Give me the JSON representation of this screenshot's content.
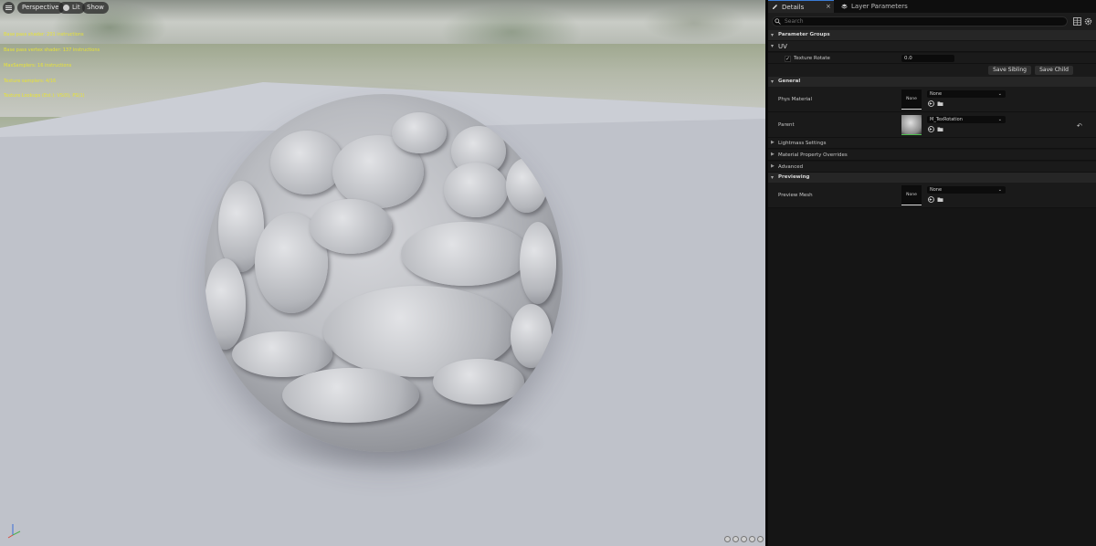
{
  "viewport": {
    "menu_icon": "hamburger-icon",
    "perspective_label": "Perspective",
    "lit_label": "Lit",
    "show_label": "Show",
    "stats": [
      "Base pass shader: 201 instructions",
      "Base pass vertex shader: 137 instructions",
      "MaxSamplers: 16 instructions",
      "Texture samplers: 4/16",
      "Texture Lookups (Est.): VS(0), PS(1)"
    ],
    "stats_color": "#e8e337"
  },
  "panel": {
    "tabs": [
      {
        "label": "Details",
        "icon": "pencil-icon"
      },
      {
        "label": "Layer Parameters",
        "icon": "layers-icon"
      }
    ],
    "close_glyph": "×",
    "search_placeholder": "Search",
    "sections": {
      "parameter_groups": "Parameter Groups",
      "uv": "UV",
      "general": "General",
      "previewing": "Previewing"
    },
    "texture_rotate": {
      "label": "Texture Rotate",
      "value": "0.0",
      "checked": true
    },
    "buttons": {
      "save_sibling": "Save Sibling",
      "save_child": "Save Child"
    },
    "phys_material": {
      "label": "Phys Material",
      "thumb": "None",
      "value": "None"
    },
    "parent": {
      "label": "Parent",
      "value": "M_TexRotation"
    },
    "collapsed_groups": [
      "Lightmass Settings",
      "Material Property Overrides",
      "Advanced"
    ],
    "preview_mesh": {
      "label": "Preview Mesh",
      "thumb": "None",
      "value": "None"
    },
    "accent_color": "#3a7bd5"
  }
}
